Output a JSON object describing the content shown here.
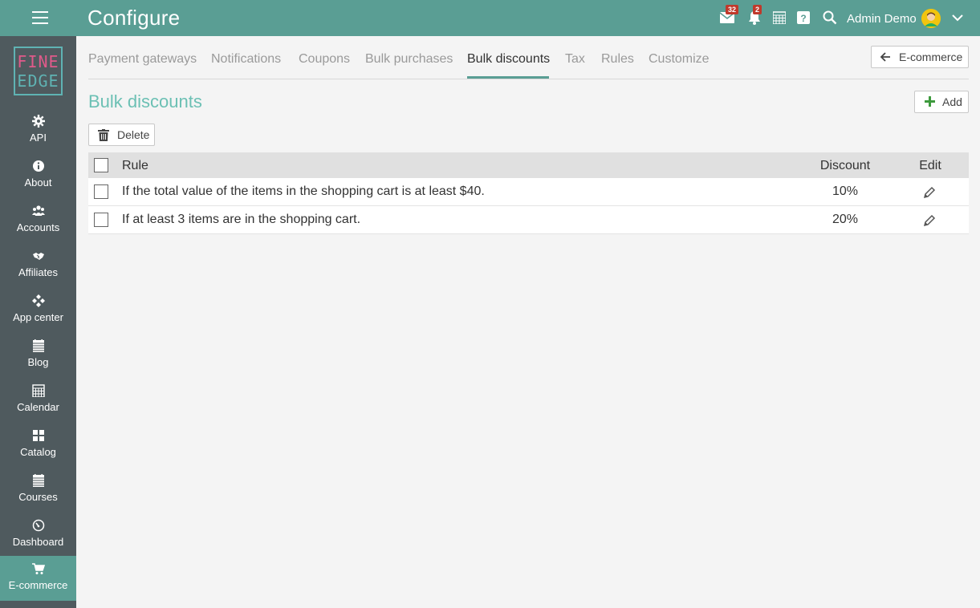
{
  "header": {
    "title": "Configure",
    "mail_count": "32",
    "notif_count": "2",
    "user_name": "Admin Demo"
  },
  "sidebar": {
    "logo_line1": "FINE",
    "logo_line2": "EDGE",
    "items": [
      {
        "label": "API",
        "icon": "gear-icon"
      },
      {
        "label": "About",
        "icon": "info-icon"
      },
      {
        "label": "Accounts",
        "icon": "users-icon"
      },
      {
        "label": "Affiliates",
        "icon": "handshake-icon"
      },
      {
        "label": "App center",
        "icon": "diamond-grid-icon"
      },
      {
        "label": "Blog",
        "icon": "calendar-icon"
      },
      {
        "label": "Calendar",
        "icon": "calendar-grid-icon"
      },
      {
        "label": "Catalog",
        "icon": "grid-icon"
      },
      {
        "label": "Courses",
        "icon": "calendar-icon"
      },
      {
        "label": "Dashboard",
        "icon": "gauge-icon"
      },
      {
        "label": "E-commerce",
        "icon": "cart-icon",
        "active": true
      }
    ]
  },
  "tabs": [
    {
      "label": "Payment gateways"
    },
    {
      "label": "Notifications"
    },
    {
      "label": "Coupons"
    },
    {
      "label": "Bulk purchases"
    },
    {
      "label": "Bulk discounts",
      "active": true
    },
    {
      "label": "Tax"
    },
    {
      "label": "Rules"
    },
    {
      "label": "Customize"
    }
  ],
  "back_button": "E-commerce",
  "page_title": "Bulk discounts",
  "add_button": "Add",
  "delete_button": "Delete",
  "table": {
    "headers": {
      "rule": "Rule",
      "discount": "Discount",
      "edit": "Edit"
    },
    "rows": [
      {
        "rule": "If the total value of the items in the shopping cart is at least $40.",
        "discount": "10%"
      },
      {
        "rule": "If at least 3 items are in the shopping cart.",
        "discount": "20%"
      }
    ]
  },
  "colors": {
    "accent": "#5a9e94",
    "sidebar": "#4f5a5e",
    "title": "#6cc0b4",
    "badge": "#c0392b"
  }
}
